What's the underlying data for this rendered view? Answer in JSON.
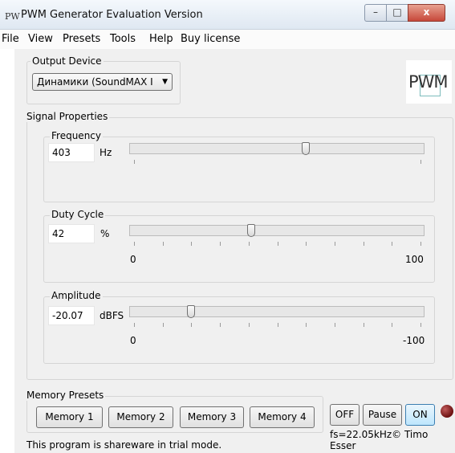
{
  "window": {
    "app_icon": "PW",
    "title": "PWM Generator Evaluation Version",
    "minimize_glyph": "–",
    "maximize_glyph": "□",
    "close_glyph": "x"
  },
  "menu": [
    "File",
    "View",
    "Presets",
    "Tools",
    "Help",
    "Buy license"
  ],
  "output_device": {
    "legend": "Output Device",
    "selected": "Динамики (SoundMAX I",
    "arrow": "▼"
  },
  "logo": {
    "text": "PWM"
  },
  "signal": {
    "legend": "Signal Properties",
    "frequency": {
      "legend": "Frequency",
      "value": "403",
      "unit": "Hz",
      "slider_fraction": 0.61
    },
    "duty": {
      "legend": "Duty Cycle",
      "value": "42",
      "unit": "%",
      "min_label": "0",
      "max_label": "100",
      "slider_fraction": 0.42
    },
    "amplitude": {
      "legend": "Amplitude",
      "value": "-20.07",
      "unit": "dBFS",
      "min_label": "0",
      "max_label": "-100",
      "slider_fraction": 0.21
    }
  },
  "memory": {
    "legend": "Memory Presets",
    "buttons": [
      "Memory 1",
      "Memory 2",
      "Memory 3",
      "Memory 4"
    ]
  },
  "controls": {
    "off": "OFF",
    "pause": "Pause",
    "on": "ON"
  },
  "credit": "fs=22.05kHz© Timo Esser",
  "status": "This program is shareware in trial mode.",
  "colors": {
    "on_button": "#bee6fd",
    "led": "#6b1010",
    "client_bg": "#f0f0f0"
  }
}
